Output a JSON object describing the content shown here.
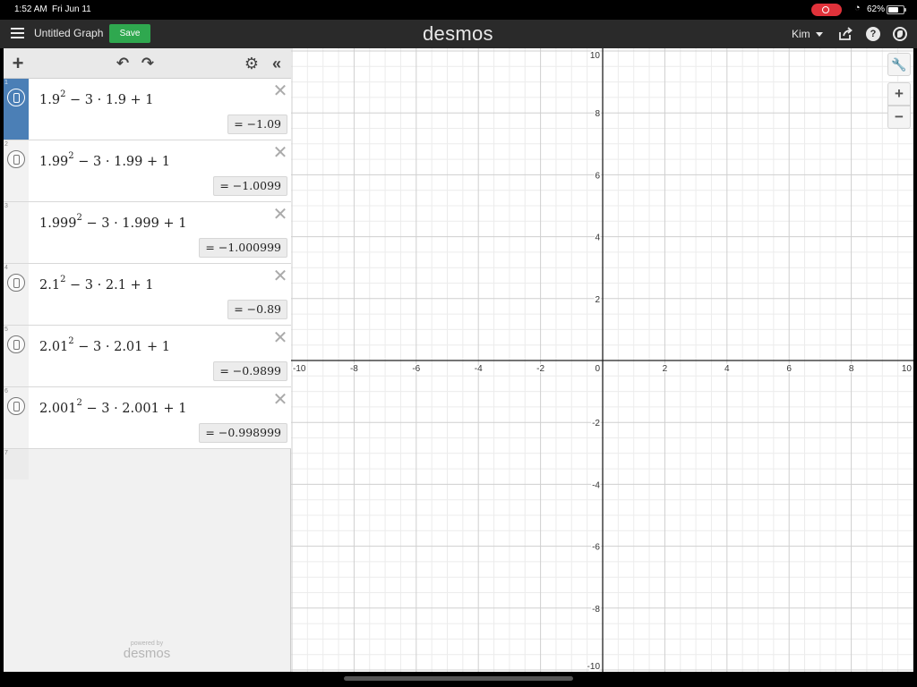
{
  "status_bar": {
    "time": "1:52 AM",
    "date": "Fri Jun 11",
    "battery": "62%"
  },
  "header": {
    "title": "Untitled Graph",
    "save_label": "Save",
    "brand": "desmos",
    "user": "Kim",
    "help_glyph": "?"
  },
  "toolbar": {
    "add_glyph": "+",
    "undo_glyph": "↶",
    "redo_glyph": "↷",
    "settings_glyph": "⚙",
    "collapse_glyph": "«"
  },
  "expressions": [
    {
      "num": "1",
      "base": "1.9",
      "exp": "2",
      "rest": " − 3 · 1.9 + 1",
      "result": "= −1.09",
      "active": true
    },
    {
      "num": "2",
      "base": "1.99",
      "exp": "2",
      "rest": " − 3 · 1.99 + 1",
      "result": "= −1.0099",
      "active": false
    },
    {
      "num": "3",
      "base": "1.999",
      "exp": "2",
      "rest": " − 3 · 1.999 + 1",
      "result": "= −1.000999",
      "active": false
    },
    {
      "num": "4",
      "base": "2.1",
      "exp": "2",
      "rest": " − 3 · 2.1 + 1",
      "result": "= −0.89",
      "active": false
    },
    {
      "num": "5",
      "base": "2.01",
      "exp": "2",
      "rest": " − 3 · 2.01 + 1",
      "result": "= −0.9899",
      "active": false
    },
    {
      "num": "6",
      "base": "2.001",
      "exp": "2",
      "rest": " − 3 · 2.001 + 1",
      "result": "= −0.998999",
      "active": false
    }
  ],
  "empty_row_num": "7",
  "footer": {
    "powered_by": "powered by",
    "brand": "desmos"
  },
  "graph": {
    "x_range": [
      -10,
      10
    ],
    "y_range": [
      -10,
      10
    ],
    "major_step": 2,
    "minor_step": 0.5,
    "x_ticks": [
      "-10",
      "-8",
      "-6",
      "-4",
      "-2",
      "0",
      "2",
      "4",
      "6",
      "8",
      "10"
    ],
    "y_ticks": [
      "10",
      "8",
      "6",
      "4",
      "2",
      "-2",
      "-4",
      "-6",
      "-8",
      "-10"
    ],
    "tools": {
      "zoom_in": "+",
      "zoom_out": "−"
    }
  },
  "colors": {
    "accent_blue": "#4b7fb6",
    "save_green": "#2fa84f",
    "header_bg": "#2a2a2a",
    "grid_minor": "#ececec",
    "grid_major": "#cfcfcf",
    "axis": "#222222"
  }
}
